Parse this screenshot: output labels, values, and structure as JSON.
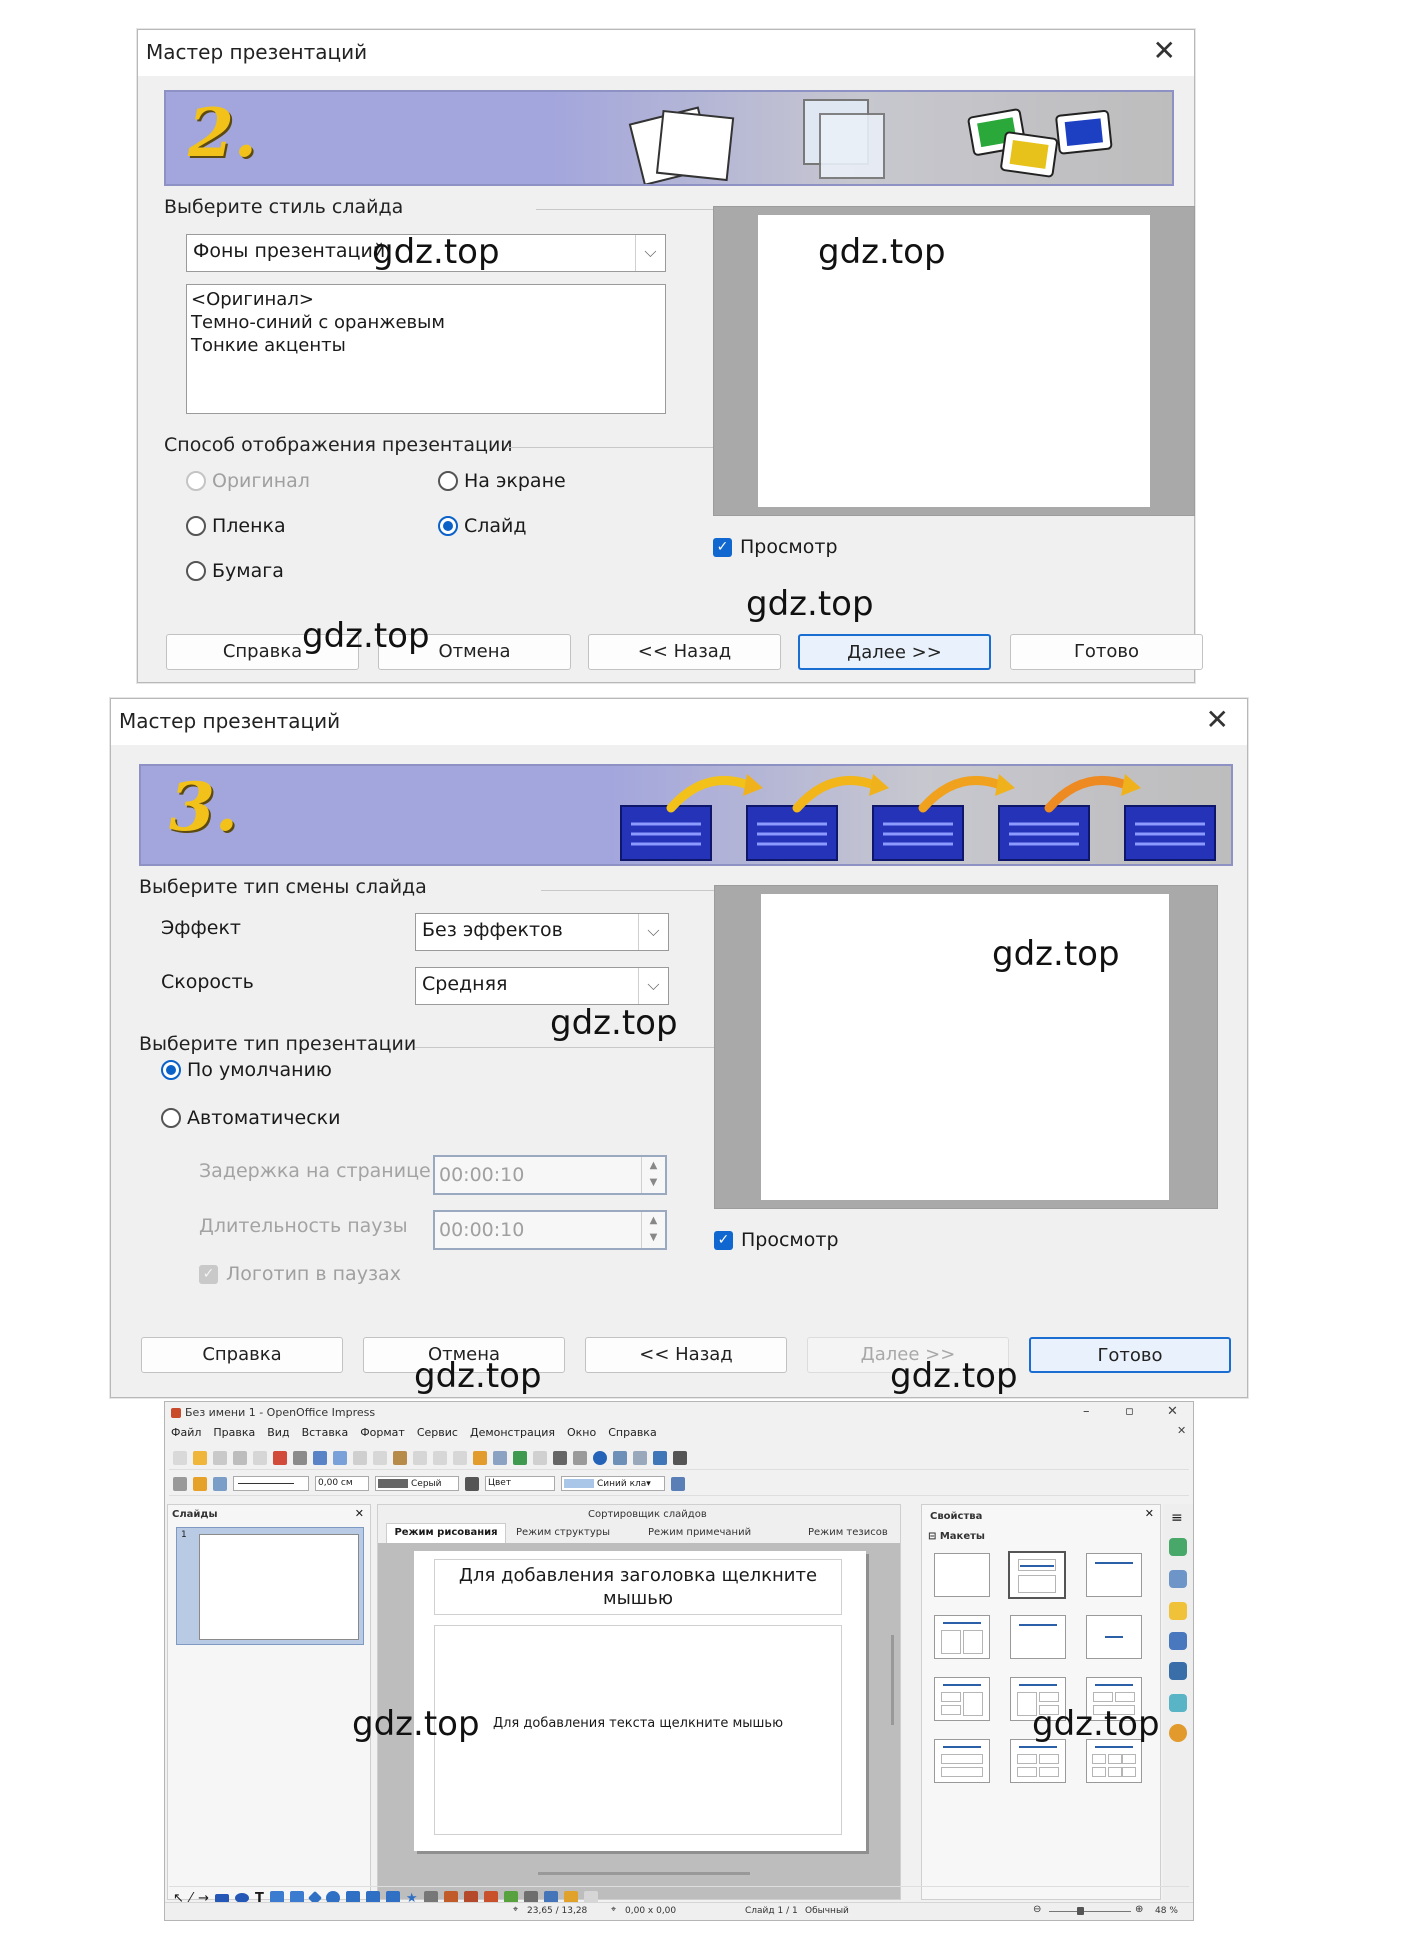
{
  "dialog1": {
    "title": "Мастер презентаций",
    "close": "✕",
    "step": "2.",
    "style_group": "Выберите стиль слайда",
    "style_select": "Фоны презентаций",
    "style_list": [
      "<Оригинал>",
      "Темно-синий с оранжевым",
      "Тонкие акценты"
    ],
    "output_group": "Способ отображения презентации",
    "output_options": [
      {
        "label": "Оригинал",
        "checked": false,
        "disabled": true
      },
      {
        "label": "На экране",
        "checked": false,
        "disabled": false
      },
      {
        "label": "Пленка",
        "checked": false,
        "disabled": false
      },
      {
        "label": "Слайд",
        "checked": true,
        "disabled": false
      },
      {
        "label": "Бумага",
        "checked": false,
        "disabled": false
      }
    ],
    "preview_label": "Просмотр",
    "buttons": {
      "help": "Справка",
      "cancel": "Отмена",
      "back": "<< Назад",
      "next": "Далее >>",
      "finish": "Готово"
    }
  },
  "dialog2": {
    "title": "Мастер презентаций",
    "close": "✕",
    "step": "3.",
    "transition_group": "Выберите тип смены слайда",
    "effect_label": "Эффект",
    "effect_value": "Без эффектов",
    "speed_label": "Скорость",
    "speed_value": "Средняя",
    "type_group": "Выберите тип презентации",
    "type_default": "По умолчанию",
    "type_auto": "Автоматически",
    "delay_label": "Задержка на странице",
    "delay_value": "00:00:10",
    "pause_label": "Длительность паузы",
    "pause_value": "00:00:10",
    "logo_label": "Логотип в паузах",
    "preview_label": "Просмотр",
    "buttons": {
      "help": "Справка",
      "cancel": "Отмена",
      "back": "<< Назад",
      "next": "Далее >>",
      "finish": "Готово"
    }
  },
  "openoffice": {
    "title": "Без имени 1 - OpenOffice Impress",
    "menu": [
      "Файл",
      "Правка",
      "Вид",
      "Вставка",
      "Формат",
      "Сервис",
      "Демонстрация",
      "Окно",
      "Справка"
    ],
    "line_width": "0,00 см",
    "line_color": "Серый",
    "fill_type": "Цвет",
    "fill_color": "Синий кла▾",
    "slides_panel": "Слайды",
    "slide_number": "1",
    "sorter_title": "Сортировщик слайдов",
    "view_tabs": [
      "Режим рисования",
      "Режим структуры",
      "Режим примечаний",
      "Режим тезисов"
    ],
    "title_placeholder": "Для добавления заголовка щелкните мышью",
    "text_placeholder": "Для добавления текста щелкните мышью",
    "properties_title": "Свойства",
    "layouts_title": "⊟ Макеты",
    "status": {
      "position": "23,65 / 13,28",
      "size": "0,00 x 0,00",
      "slide": "Слайд 1 / 1",
      "layout": "Обычный",
      "zoom": "48 %"
    }
  },
  "watermarks": [
    "gdz.top",
    "gdz.top",
    "gdz.top",
    "gdz.top",
    "gdz.top",
    "gdz.top",
    "gdz.top",
    "gdz.top",
    "gdz.top",
    "gdz.top",
    "gdz.top"
  ],
  "colors": {
    "banner": "#a3a6dc",
    "accent": "#1067d0",
    "step_number": "#f2c21a"
  }
}
